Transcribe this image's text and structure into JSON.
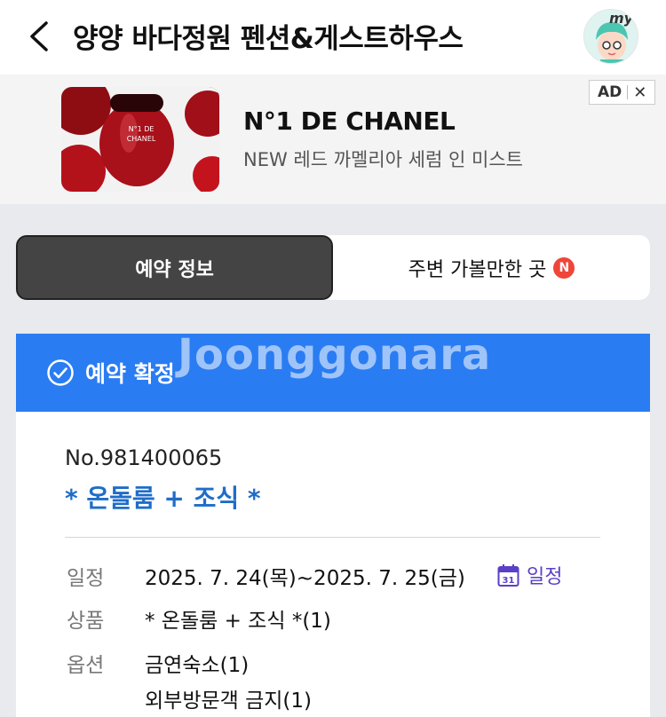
{
  "header": {
    "title": "양양 바다정원 펜션&게스트하우스",
    "avatar_text": "my"
  },
  "ad": {
    "title": "N°1 DE CHANEL",
    "subtitle": "NEW 레드 까멜리아 세럼 인 미스트",
    "badge": "AD",
    "close": "✕",
    "product_text": "N°1 DE CHANEL"
  },
  "tabs": [
    {
      "label": "예약 정보",
      "active": true
    },
    {
      "label": "주변 가볼만한 곳",
      "active": false,
      "badge": "N"
    }
  ],
  "status": {
    "label": "예약 확정",
    "color": "#2a7cf2"
  },
  "booking": {
    "number": "No.981400065",
    "room": "* 온돌룸 + 조식 *",
    "rows": [
      {
        "label": "일정",
        "value": "2025. 7. 24(목)~2025. 7. 25(금)"
      },
      {
        "label": "상품",
        "value": "* 온돌룸 + 조식 *(1)"
      },
      {
        "label": "옵션",
        "value": "금연숙소(1)",
        "value2": "외부방문객 금지(1)"
      }
    ],
    "calendar_link": "일정",
    "calendar_day": "31"
  },
  "watermark": "Joonggonara"
}
